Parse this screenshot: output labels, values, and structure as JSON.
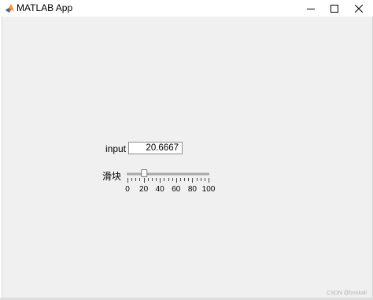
{
  "window": {
    "title": "MATLAB App",
    "icon": "matlab-logo-icon",
    "controls": [
      "minimize-icon",
      "maximize-icon",
      "close-icon"
    ]
  },
  "form": {
    "input_label": "input",
    "input_value": "20.6667",
    "slider_label": "滑块",
    "slider": {
      "min": 0,
      "max": 100,
      "value": 20.6667,
      "ticks": [
        "0",
        "20",
        "40",
        "60",
        "80",
        "100"
      ]
    }
  },
  "watermark": "CSDN @bnnkali"
}
